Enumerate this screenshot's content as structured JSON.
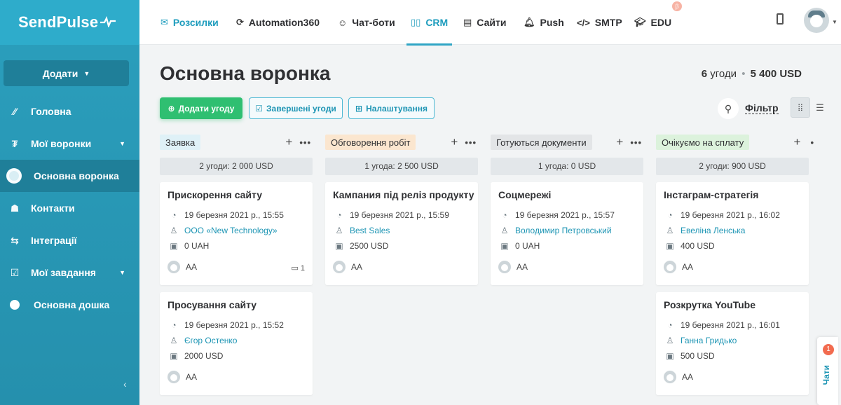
{
  "brand": {
    "name": "SendPulse",
    "pulse": "⁄\\⁄"
  },
  "sidebar": {
    "add_label": "Додати",
    "items": [
      {
        "label": "Головна",
        "icon": "trend-icon"
      },
      {
        "label": "Мої воронки",
        "icon": "funnel-icon"
      },
      {
        "label": "Основна воронка",
        "icon": "circle-icon"
      },
      {
        "label": "Контакти",
        "icon": "contacts-icon"
      },
      {
        "label": "Інтеграції",
        "icon": "arrows-icon"
      },
      {
        "label": "Мої завдання",
        "icon": "checkbox-icon"
      },
      {
        "label": "Основна дошка",
        "icon": "circle-icon"
      }
    ]
  },
  "topnav": {
    "tabs": [
      {
        "label": "Розсилки",
        "icon": "mail-icon"
      },
      {
        "label": "Automation360",
        "icon": "automation-icon"
      },
      {
        "label": "Чат-боти",
        "icon": "chatbot-icon"
      },
      {
        "label": "CRM",
        "icon": "crm-icon"
      },
      {
        "label": "Сайти",
        "icon": "site-icon"
      },
      {
        "label": "Push",
        "icon": "bell-icon"
      },
      {
        "label": "SMTP",
        "icon": "code-icon"
      },
      {
        "label": "EDU",
        "icon": "graduation-icon"
      }
    ],
    "beta": "β"
  },
  "page": {
    "title": "Основна воронка",
    "summary_count": "6",
    "summary_count_label": "угоди",
    "summary_sep": "•",
    "summary_amount": "5 400 USD"
  },
  "toolbar": {
    "add_deal": "Додати угоду",
    "completed": "Завершені угоди",
    "settings": "Налаштування",
    "filter": "Фільтр"
  },
  "columns": [
    {
      "stage": "Заявка",
      "stage_color": "#dff1f7",
      "summary": "2 угоди: 2 000 USD",
      "cards": [
        {
          "title": "Прискорення сайту",
          "date": "19 березня 2021 р., 15:55",
          "contact": "ООО «New Technology»",
          "amount": "0 UAH",
          "owner": "AA",
          "comments": "1"
        },
        {
          "title": "Просування сайту",
          "date": "19 березня 2021 р., 15:52",
          "contact": "Єгор Остенко",
          "amount": "2000 USD",
          "owner": "AA",
          "comments": ""
        }
      ]
    },
    {
      "stage": "Обговорення робіт",
      "stage_color": "#fbe6cf",
      "summary": "1 угода: 2 500 USD",
      "cards": [
        {
          "title": "Кампания під реліз продукту",
          "date": "19 березня 2021 р., 15:59",
          "contact": "Best Sales",
          "amount": "2500 USD",
          "owner": "AA",
          "comments": ""
        }
      ]
    },
    {
      "stage": "Готуються документи",
      "stage_color": "#e3e5e7",
      "summary": "1 угода: 0 USD",
      "cards": [
        {
          "title": "Соцмережі",
          "date": "19 березня 2021 р., 15:57",
          "contact": "Володимир Петровський",
          "amount": "0 UAH",
          "owner": "AA",
          "comments": ""
        }
      ]
    },
    {
      "stage": "Очікуємо на сплату",
      "stage_color": "#dcf2dc",
      "summary": "2 угоди: 900 USD",
      "cards": [
        {
          "title": "Інстаграм-стратегія",
          "date": "19 березня 2021 р., 16:02",
          "contact": "Евеліна Ленська",
          "amount": "400 USD",
          "owner": "AA",
          "comments": ""
        },
        {
          "title": "Розкрутка YouTube",
          "date": "19 березня 2021 р., 16:01",
          "contact": "Ганна Гридько",
          "amount": "500 USD",
          "owner": "AA",
          "comments": ""
        }
      ]
    }
  ],
  "chat": {
    "label": "Чати",
    "badge": "1"
  },
  "colors": {
    "sidebar": "#2b9fbd",
    "accent": "#1d9cbd",
    "green": "#2fbf71"
  }
}
